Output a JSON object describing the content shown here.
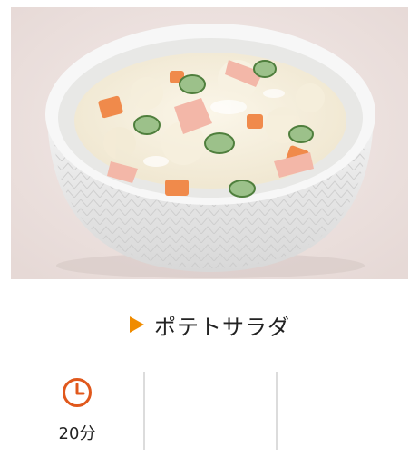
{
  "recipe": {
    "image_subject": "potato-salad-bowl",
    "title": "ポテトサラダ",
    "accent_color": "#f08c00"
  },
  "meta": {
    "time_icon": "clock-icon",
    "time": "20分",
    "icon_color": "#e0581c"
  }
}
